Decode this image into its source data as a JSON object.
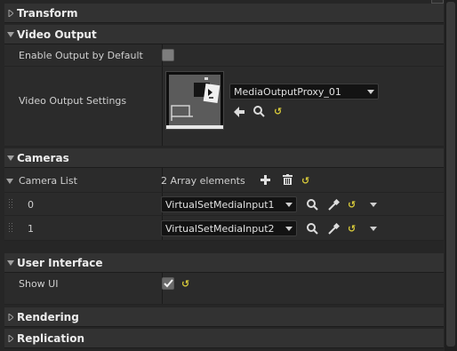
{
  "categories": {
    "transform": "Transform",
    "video_output": "Video Output",
    "cameras": "Cameras",
    "user_interface": "User Interface",
    "rendering": "Rendering",
    "replication": "Replication"
  },
  "video_output": {
    "enable_label": "Enable Output by Default",
    "enable_checked": false,
    "settings_label": "Video Output Settings",
    "settings_asset": "MediaOutputProxy_01"
  },
  "cameras": {
    "list_label": "Camera List",
    "count_text": "2 Array elements",
    "elements": [
      {
        "index": "0",
        "value": "VirtualSetMediaInput1"
      },
      {
        "index": "1",
        "value": "VirtualSetMediaInput2"
      }
    ]
  },
  "user_interface": {
    "show_ui_label": "Show UI",
    "show_ui_checked": true
  },
  "reset_glyph": "↺",
  "colors": {
    "panel_bg": "#262626",
    "header_bg": "#323232",
    "reset_yellow": "#d6c83a"
  }
}
